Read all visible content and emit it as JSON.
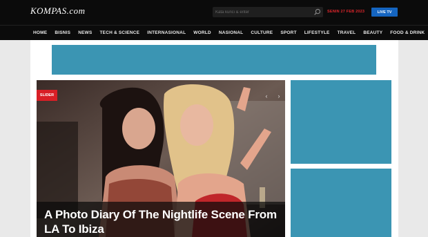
{
  "brand": {
    "logo_text": "KOMPAS.com"
  },
  "header": {
    "search": {
      "placeholder": "Kata kunci & enter",
      "icon": "search-icon"
    },
    "date": "SENIN 27 FEB 2023",
    "live_label": "LIVE TV"
  },
  "nav": {
    "items": [
      "HOME",
      "BISNIS",
      "NEWS",
      "TECH & SCIENCE",
      "INTERNASIONAL",
      "WORLD",
      "NASIONAL",
      "CULTURE",
      "SPORT",
      "LIFESTYLE",
      "TRAVEL",
      "BEAUTY",
      "FOOD & DRINK"
    ]
  },
  "slider": {
    "badge": "SLIDER",
    "prev_icon": "chevron-left-icon",
    "next_icon": "chevron-right-icon",
    "headline": "A Photo Diary Of The Nightlife Scene From LA To Ibiza"
  },
  "colors": {
    "header_bg": "#0b0b0b",
    "accent_red": "#d81f26",
    "live_blue": "#1565c0",
    "ad_placeholder": "#3b95b3"
  }
}
